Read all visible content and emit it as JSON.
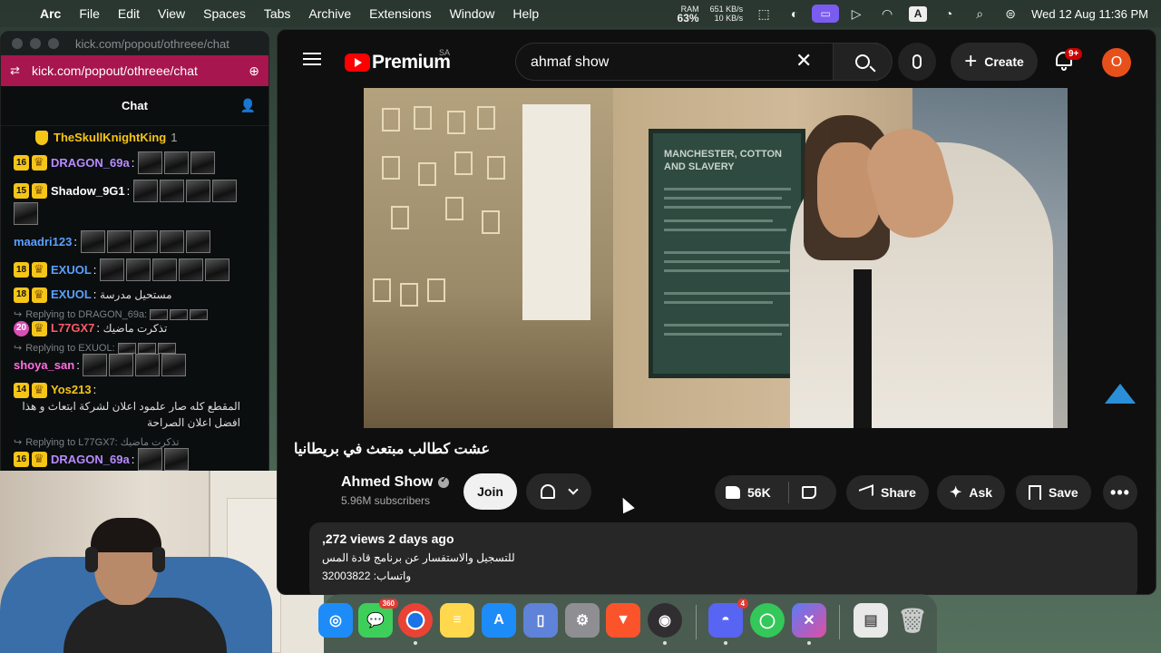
{
  "menubar": {
    "app": "Arc",
    "items": [
      "File",
      "Edit",
      "View",
      "Spaces",
      "Tabs",
      "Archive",
      "Extensions",
      "Window",
      "Help"
    ],
    "ram_label": "RAM",
    "ram_value": "63%",
    "net_up": "651 KB/s",
    "net_down": "10 KB/s",
    "input_source": "A",
    "clock": "Wed 12 Aug  11:36 PM"
  },
  "chat_window": {
    "title_url": "kick.com/popout/othreee/chat",
    "address_url": "kick.com/popout/othreee/chat",
    "header": "Chat",
    "messages": [
      {
        "type": "pinned",
        "user": "TheSkullKnightKing",
        "extra": "1"
      },
      {
        "level": "16",
        "user": "DRAGON_69a",
        "sep": ":",
        "user_color": "#b98bff",
        "text": "",
        "emotes": 3
      },
      {
        "level": "15",
        "user": "Shadow_9G1",
        "sep": ":",
        "user_color": "#ffffff",
        "text": "",
        "emotes": 5
      },
      {
        "level": "",
        "user": "maadri123",
        "sep": ":",
        "user_color": "#5aa0ff",
        "text": "",
        "emotes": 5
      },
      {
        "level": "18",
        "user": "EXUOL",
        "sep": ":",
        "user_color": "#5aa0ff",
        "text": "",
        "emotes": 5
      },
      {
        "level": "18",
        "user": "EXUOL",
        "sep": ":",
        "user_color": "#5aa0ff",
        "text": "مستحيل مدرسة",
        "emotes": 0
      },
      {
        "reply_to": "Replying to DRAGON_69a:",
        "level": "20",
        "user": "L77GX7",
        "sep": ":",
        "user_color": "#ff5a6a",
        "text": "تذكرت ماضيك",
        "emotes": 0
      },
      {
        "reply_to": "Replying to EXUOL:",
        "level": "",
        "user": "shoya_san",
        "sep": ":",
        "user_color": "#ff6ee0",
        "text": "",
        "emotes": 4
      },
      {
        "level": "14",
        "user": "Yos213",
        "sep": ":",
        "user_color": "#f5c518",
        "text": "المقطع كله صار علمود اعلان لشركة ابتعاث و هذا افضل اعلان الصراحة",
        "emotes": 0
      },
      {
        "reply_to": "Replying to L77GX7: تذكرت ماضيك",
        "level": "16",
        "user": "DRAGON_69a",
        "sep": ":",
        "user_color": "#b98bff",
        "text": "",
        "emotes": 2
      }
    ]
  },
  "youtube": {
    "brand": "Premium",
    "region": "SA",
    "search_value": "ahmaf show",
    "create_label": "Create",
    "notifications_badge": "9+",
    "avatar_letter": "O",
    "video_poster_title": "MANCHESTER, COTTON AND SLAVERY",
    "video_title": "عشت كطالب مبتعث في بريطانيا",
    "channel_name": "Ahmed Show",
    "subscribers": "5.96M subscribers",
    "join_label": "Join",
    "likes": "56K",
    "share_label": "Share",
    "ask_label": "Ask",
    "save_label": "Save",
    "more_label": "•••",
    "description": {
      "meta": ",272 views  2 days ago",
      "line1": "للتسجيل والاستفسار عن برنامج قادة المس",
      "line2": "واتساب: 32003822"
    }
  },
  "dock": {
    "messages_badge": "360",
    "discord_badge": "4"
  },
  "colors": {
    "kick_urlbar": "#a7164f",
    "yt_red": "#ff0000",
    "avatar": "#e8501b",
    "level_badge": "#f5c518"
  }
}
